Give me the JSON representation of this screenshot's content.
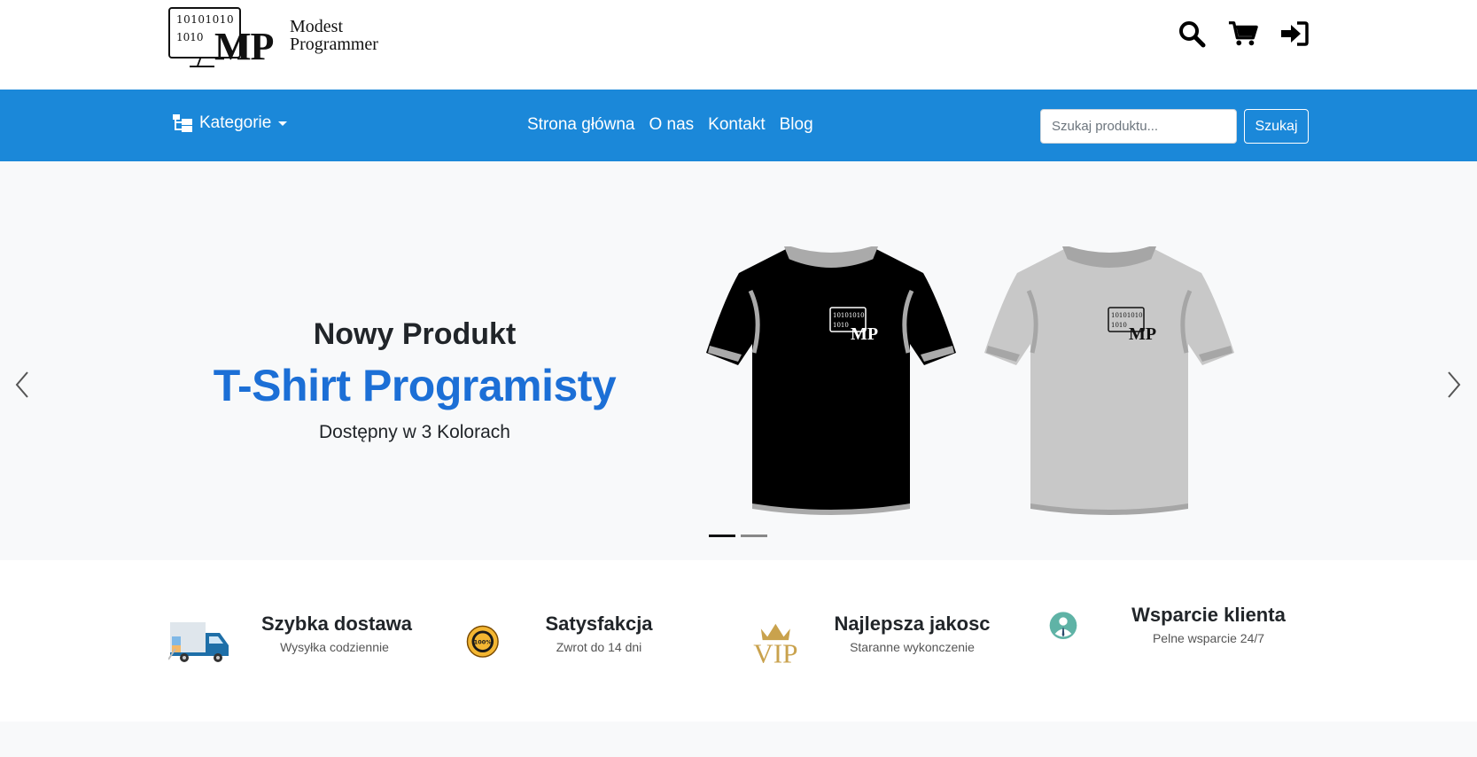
{
  "brand": {
    "binary_line1": "10101010",
    "binary_line2": "1010",
    "monogram": "MP",
    "name_line1": "Modest",
    "name_line2": "Programmer"
  },
  "top_icons": [
    "search-icon",
    "cart-icon",
    "sign-in-icon"
  ],
  "navbar": {
    "categories_label": "Kategorie",
    "links": [
      "Strona główna",
      "O nas",
      "Kontakt",
      "Blog"
    ],
    "search_placeholder": "Szukaj produktu...",
    "search_button": "Szukaj",
    "color": "#1b88d9"
  },
  "hero": {
    "subtitle": "Nowy Produkt",
    "title": "T-Shirt Programisty",
    "description": "Dostępny w 3 Kolorach",
    "title_color": "#1c6fd6",
    "slides_count": 2,
    "active_slide": 1,
    "shirt_logo_binary1": "10101010",
    "shirt_logo_binary2": "1010",
    "shirt_logo_monogram": "MP"
  },
  "features": [
    {
      "icon": "delivery-truck-icon",
      "title": "Szybka dostawa",
      "desc": "Wysyłka codziennie"
    },
    {
      "icon": "satisfaction-badge-icon",
      "title": "Satysfakcja",
      "desc": "Zwrot do 14 dni"
    },
    {
      "icon": "vip-crown-icon",
      "title": "Najlepsza jakosc",
      "desc": "Staranne wykonczenie"
    },
    {
      "icon": "support-agent-icon",
      "title": "Wsparcie klienta",
      "desc": "Pelne wsparcie 24/7"
    }
  ]
}
